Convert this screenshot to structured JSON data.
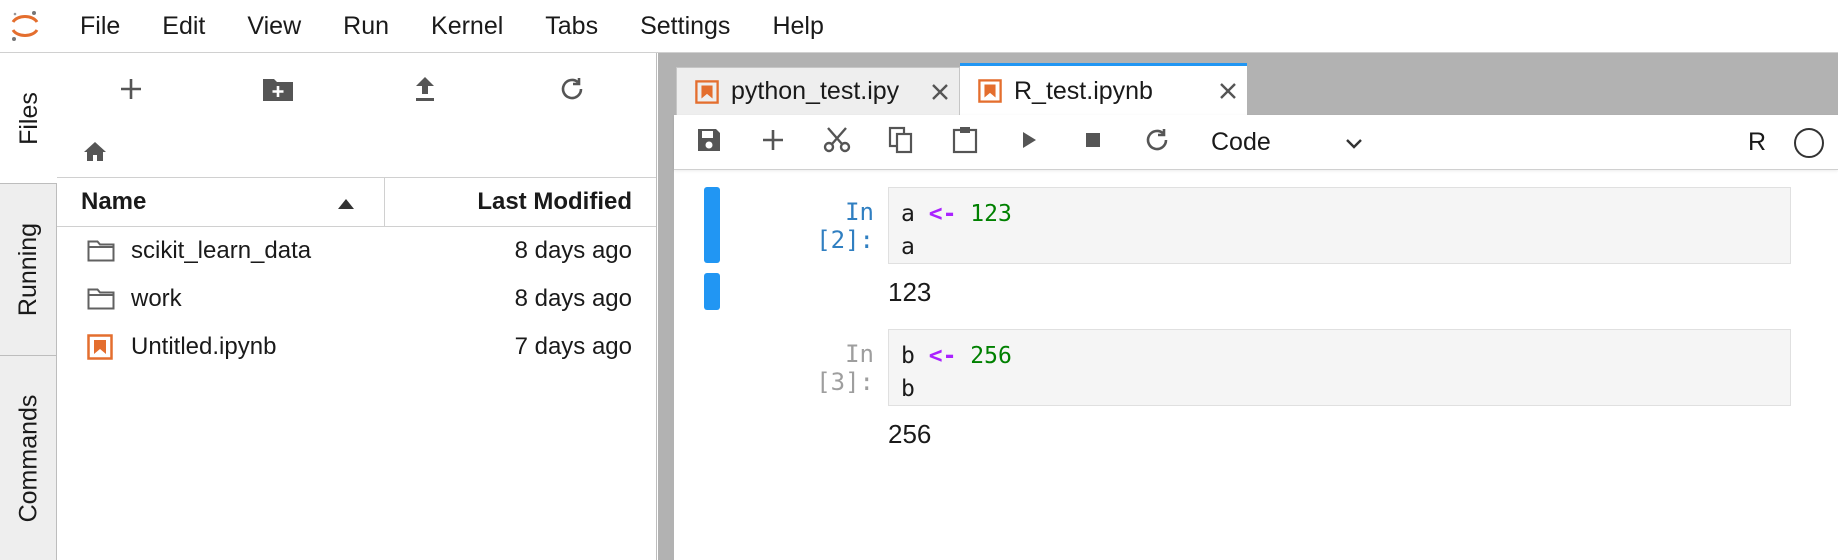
{
  "menubar": {
    "items": [
      "File",
      "Edit",
      "View",
      "Run",
      "Kernel",
      "Tabs",
      "Settings",
      "Help"
    ]
  },
  "sidetabs": [
    "Files",
    "Running",
    "Commands"
  ],
  "filebrowser": {
    "toolbar_icons": [
      "add-icon",
      "new-folder-icon",
      "upload-icon",
      "refresh-icon"
    ],
    "breadcrumb_icon": "home-icon",
    "columns": {
      "name": "Name",
      "modified": "Last Modified"
    },
    "files": [
      {
        "name": "scikit_learn_data",
        "modified": "8 days ago",
        "type": "folder"
      },
      {
        "name": "work",
        "modified": "8 days ago",
        "type": "folder"
      },
      {
        "name": "Untitled.ipynb",
        "modified": "7 days ago",
        "type": "notebook"
      }
    ]
  },
  "tabs": [
    {
      "label": "python_test.ipynb",
      "display": "python_test.ipy",
      "active": false
    },
    {
      "label": "R_test.ipynb",
      "display": "R_test.ipynb",
      "active": true
    }
  ],
  "notebook": {
    "toolbar_icons": [
      "save-icon",
      "add-icon",
      "cut-icon",
      "copy-icon",
      "paste-icon",
      "run-icon",
      "stop-icon",
      "restart-icon"
    ],
    "cell_type": "Code",
    "kernel": "R",
    "cells": [
      {
        "prompt": "In [2]:",
        "code_line1_var": "a",
        "code_line1_op": "<-",
        "code_line1_num": "123",
        "code_line2": "a",
        "output": "123"
      },
      {
        "prompt": "In [3]:",
        "code_line1_var": "b",
        "code_line1_op": "<-",
        "code_line1_num": "256",
        "code_line2": "b",
        "output": "256"
      }
    ]
  },
  "colors": {
    "accent": "#2196f3",
    "notebook_icon": "#e46e2e",
    "prompt_active": "#307fc1",
    "prompt_inactive": "#9e9e9e",
    "operator": "#aa22ff",
    "number": "#008000"
  }
}
